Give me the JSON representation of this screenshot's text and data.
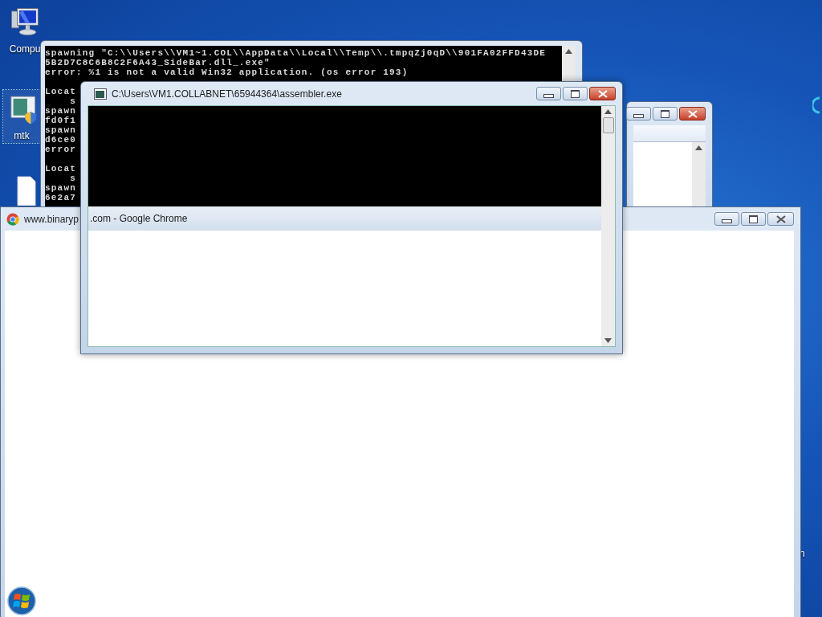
{
  "desktop": {
    "icons": [
      {
        "kind": "computer",
        "label": "Compu",
        "selected": false
      },
      {
        "kind": "program",
        "label": "mtk",
        "selected": true
      },
      {
        "kind": "document"
      },
      {
        "kind": "label_only",
        "label": "n"
      }
    ]
  },
  "console_window": {
    "blocks": [
      {
        "lines": [
          "spawning \"C:\\\\Users\\\\VM1~1.COL\\\\AppData\\\\Local\\\\Temp\\\\.tmpqZj0qD\\\\901FA02FFD43DE",
          "5B2D7C8C6B8C2F6A43_SideBar.dll_.exe\"",
          "error: %1 is not a valid Win32 application. (os error 193)"
        ]
      },
      {
        "lines": [
          "Locat",
          "    s",
          "spawn",
          "fd0f1",
          "spawn",
          "d6ce0",
          "error"
        ]
      },
      {
        "lines": [
          "Locat",
          "    s",
          "spawn",
          "6e2a7"
        ]
      }
    ]
  },
  "middle_window": {
    "focused": true
  },
  "assembler_window": {
    "title": "C:\\Users\\VM1.COLLABNET\\65944364\\assembler.exe",
    "focused": true,
    "ghost_title": ".com - Google Chrome"
  },
  "chrome_window": {
    "title": "www.binaryp",
    "focused": false
  }
}
